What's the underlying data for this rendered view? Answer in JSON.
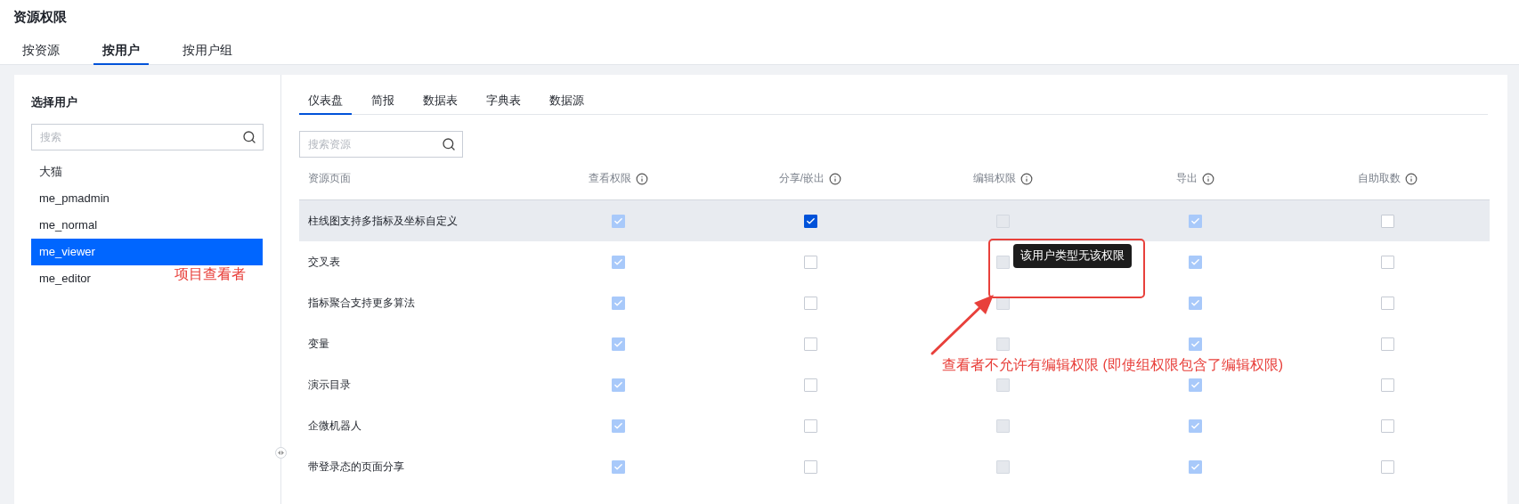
{
  "page_title": "资源权限",
  "top_tabs": [
    {
      "label": "按资源",
      "selected": false
    },
    {
      "label": "按用户",
      "selected": true
    },
    {
      "label": "按用户组",
      "selected": false
    }
  ],
  "user_panel": {
    "title": "选择用户",
    "search": {
      "placeholder": "搜索"
    },
    "users": [
      {
        "name": "大猫",
        "selected": false
      },
      {
        "name": "me_pmadmin",
        "selected": false
      },
      {
        "name": "me_normal",
        "selected": false
      },
      {
        "name": "me_viewer",
        "selected": true
      },
      {
        "name": "me_editor",
        "selected": false
      }
    ]
  },
  "resource_tabs": [
    {
      "label": "仪表盘",
      "selected": true
    },
    {
      "label": "简报",
      "selected": false
    },
    {
      "label": "数据表",
      "selected": false
    },
    {
      "label": "字典表",
      "selected": false
    },
    {
      "label": "数据源",
      "selected": false
    }
  ],
  "resource_search": {
    "placeholder": "搜索资源"
  },
  "table": {
    "columns": [
      {
        "label": "资源页面",
        "info": false
      },
      {
        "label": "查看权限",
        "info": true
      },
      {
        "label": "分享/嵌出",
        "info": true
      },
      {
        "label": "编辑权限",
        "info": true
      },
      {
        "label": "导出",
        "info": true
      },
      {
        "label": "自助取数",
        "info": true
      }
    ],
    "rows": [
      {
        "name": "柱线图支持多指标及坐标自定义",
        "highlighted": true,
        "cells": [
          {
            "checked": true,
            "disabled": true
          },
          {
            "checked": true,
            "disabled": false
          },
          {
            "checked": false,
            "disabled": true
          },
          {
            "checked": true,
            "disabled": true
          },
          {
            "checked": false,
            "disabled": false
          }
        ]
      },
      {
        "name": "交叉表",
        "highlighted": false,
        "cells": [
          {
            "checked": true,
            "disabled": true
          },
          {
            "checked": false,
            "disabled": false
          },
          {
            "checked": false,
            "disabled": true
          },
          {
            "checked": true,
            "disabled": true
          },
          {
            "checked": false,
            "disabled": false
          }
        ]
      },
      {
        "name": "指标聚合支持更多算法",
        "highlighted": false,
        "cells": [
          {
            "checked": true,
            "disabled": true
          },
          {
            "checked": false,
            "disabled": false
          },
          {
            "checked": false,
            "disabled": true
          },
          {
            "checked": true,
            "disabled": true
          },
          {
            "checked": false,
            "disabled": false
          }
        ]
      },
      {
        "name": "变量",
        "highlighted": false,
        "cells": [
          {
            "checked": true,
            "disabled": true
          },
          {
            "checked": false,
            "disabled": false
          },
          {
            "checked": false,
            "disabled": true
          },
          {
            "checked": true,
            "disabled": true
          },
          {
            "checked": false,
            "disabled": false
          }
        ]
      },
      {
        "name": "演示目录",
        "highlighted": false,
        "cells": [
          {
            "checked": true,
            "disabled": true
          },
          {
            "checked": false,
            "disabled": false
          },
          {
            "checked": false,
            "disabled": true
          },
          {
            "checked": true,
            "disabled": true
          },
          {
            "checked": false,
            "disabled": false
          }
        ]
      },
      {
        "name": "企微机器人",
        "highlighted": false,
        "cells": [
          {
            "checked": true,
            "disabled": true
          },
          {
            "checked": false,
            "disabled": false
          },
          {
            "checked": false,
            "disabled": true
          },
          {
            "checked": true,
            "disabled": true
          },
          {
            "checked": false,
            "disabled": false
          }
        ]
      },
      {
        "name": "带登录态的页面分享",
        "highlighted": false,
        "cells": [
          {
            "checked": true,
            "disabled": true
          },
          {
            "checked": false,
            "disabled": false
          },
          {
            "checked": false,
            "disabled": true
          },
          {
            "checked": true,
            "disabled": true
          },
          {
            "checked": false,
            "disabled": false
          }
        ]
      }
    ]
  },
  "tooltip": {
    "text": "该用户类型无该权限"
  },
  "annotations": [
    {
      "kind": "label",
      "text": "项目查看者"
    },
    {
      "kind": "callout",
      "text": "查看者不允许有编辑权限 (即使组权限包含了编辑权限)"
    }
  ]
}
